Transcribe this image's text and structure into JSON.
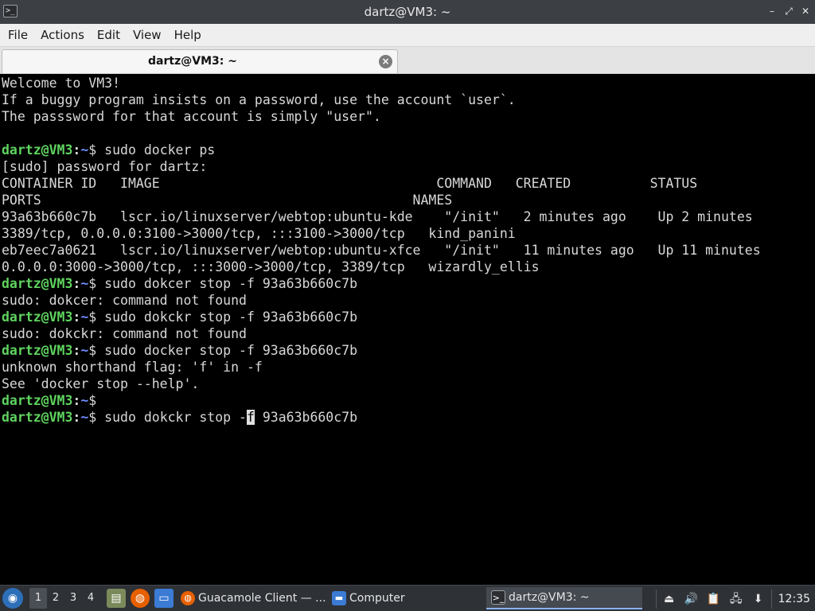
{
  "window": {
    "title": "dartz@VM3: ~",
    "app_icon_glyph": ">_",
    "controls": {
      "minimize": "–",
      "restore": "⤢",
      "close": "✕"
    }
  },
  "menu": {
    "items": [
      "File",
      "Actions",
      "Edit",
      "View",
      "Help"
    ]
  },
  "tab": {
    "label": "dartz@VM3: ~",
    "close": "×"
  },
  "terminal": {
    "prompt": {
      "user": "dartz@VM3",
      "sep": ":",
      "path": "~",
      "symbol": "$ "
    },
    "colors": {
      "user": "#5fd35f",
      "path": "#6f8cff",
      "text": "#d8d8d8",
      "background": "#000000"
    },
    "lines": [
      {
        "text": "Welcome to VM3!"
      },
      {
        "text": "If a buggy program insists on a password, use the account `user`."
      },
      {
        "text": "The passsword for that account is simply \"user\"."
      },
      {
        "text": ""
      },
      {
        "prompt": true,
        "text": "sudo docker ps"
      },
      {
        "text": "[sudo] password for dartz:"
      },
      {
        "text": "CONTAINER ID   IMAGE                                   COMMAND   CREATED          STATUS"
      },
      {
        "text": "PORTS                                               NAMES"
      },
      {
        "text": "93a63b660c7b   lscr.io/linuxserver/webtop:ubuntu-kde    \"/init\"   2 minutes ago    Up 2 minutes"
      },
      {
        "text": "3389/tcp, 0.0.0.0:3100->3000/tcp, :::3100->3000/tcp   kind_panini"
      },
      {
        "text": "eb7eec7a0621   lscr.io/linuxserver/webtop:ubuntu-xfce   \"/init\"   11 minutes ago   Up 11 minutes"
      },
      {
        "text": "0.0.0.0:3000->3000/tcp, :::3000->3000/tcp, 3389/tcp   wizardly_ellis"
      },
      {
        "prompt": true,
        "text": "sudo dokcer stop -f 93a63b660c7b"
      },
      {
        "text": "sudo: dokcer: command not found"
      },
      {
        "prompt": true,
        "text": "sudo dokckr stop -f 93a63b660c7b"
      },
      {
        "text": "sudo: dokckr: command not found"
      },
      {
        "prompt": true,
        "text": "sudo docker stop -f 93a63b660c7b"
      },
      {
        "text": "unknown shorthand flag: 'f' in -f"
      },
      {
        "text": "See 'docker stop --help'."
      },
      {
        "prompt": true,
        "text": ""
      },
      {
        "prompt": true,
        "text": "sudo dokckr stop -f 93a63b660c7b",
        "cursor_index": 18
      }
    ]
  },
  "taskbar": {
    "workspaces": [
      "1",
      "2",
      "3",
      "4"
    ],
    "active_workspace": "1",
    "launchers": [
      "files-icon",
      "firefox-icon",
      "desktop-icon"
    ],
    "tasks": [
      {
        "label": "Guacamole Client — ...",
        "icon": "firefox-icon"
      },
      {
        "label": "Computer",
        "icon": "folder-icon"
      },
      {
        "label": "dartz@VM3: ~",
        "icon": "terminal-icon",
        "active": true
      }
    ],
    "clock": "12:35"
  }
}
